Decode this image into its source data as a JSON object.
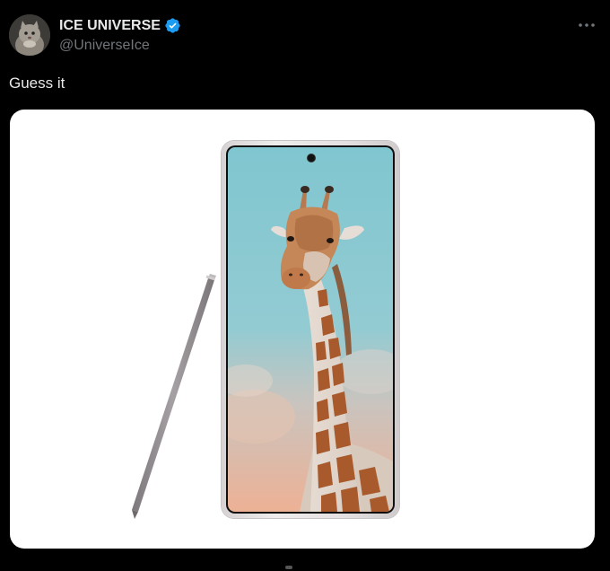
{
  "author": {
    "display_name": "ICE UNIVERSE",
    "handle": "@UniverseIce",
    "verified": true,
    "avatar_icon": "cat-avatar-icon"
  },
  "more_icon": "more-horizontal-icon",
  "tweet": {
    "text": "Guess it"
  },
  "media": {
    "subject": "phone-with-stylus-giraffe-wallpaper"
  },
  "colors": {
    "background": "#000000",
    "text_primary": "#e7e9ea",
    "text_secondary": "#71767b",
    "verified_blue": "#1d9bf0",
    "media_background": "#ffffff",
    "stylus": "#8f8a8d",
    "phone_frame": "#e4e0e1",
    "sky": "#7fc5cf"
  }
}
